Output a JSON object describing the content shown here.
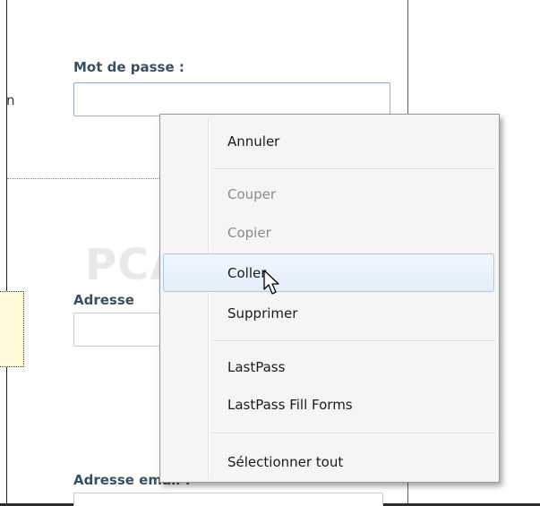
{
  "form": {
    "password_label": "Mot de passe :",
    "address_label": "Adresse",
    "email_label": "Adresse email :",
    "partial_letter": "n"
  },
  "watermark": {
    "text": "PCASTUCES"
  },
  "context_menu": {
    "items": [
      {
        "label": "Annuler",
        "enabled": true
      },
      {
        "label": "Couper",
        "enabled": false
      },
      {
        "label": "Copier",
        "enabled": false
      },
      {
        "label": "Coller",
        "enabled": true,
        "hovered": true
      },
      {
        "label": "Supprimer",
        "enabled": true
      },
      {
        "label": "LastPass",
        "enabled": true
      },
      {
        "label": "LastPass Fill Forms",
        "enabled": true
      },
      {
        "label": "Sélectionner tout",
        "enabled": true
      }
    ]
  },
  "colors": {
    "label_text": "#3a4f63",
    "input_border": "#8db2d4",
    "menu_hover": "#e3eefb",
    "disabled_text": "#8a8a8a"
  },
  "icons": {
    "cursor": "mouse-pointer-icon",
    "watermark": "lightbulb-icon"
  }
}
